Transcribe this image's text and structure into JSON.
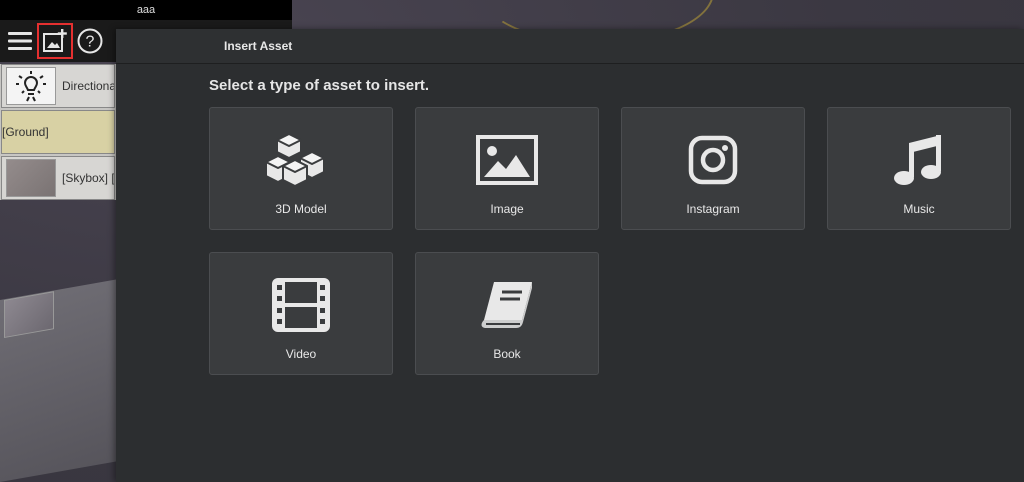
{
  "window": {
    "title": "aaa"
  },
  "toolbar": {
    "menu_icon": "hamburger-menu-icon",
    "insert_icon": "insert-image-plus-icon",
    "help_icon": "help-circle-icon",
    "highlight_color": "#e53030"
  },
  "objects": [
    {
      "label": "Directiona",
      "icon": "light-bulb-icon"
    },
    {
      "label": "[Ground]",
      "icon": "ground-thumbnail"
    },
    {
      "label": "[Skybox] [",
      "icon": "skybox-thumbnail"
    }
  ],
  "dialog": {
    "title": "Insert Asset",
    "subtitle": "Select a type of asset to insert.",
    "assets": [
      {
        "label": "3D Model",
        "icon": "cubes-icon"
      },
      {
        "label": "Image",
        "icon": "image-icon"
      },
      {
        "label": "Instagram",
        "icon": "instagram-icon"
      },
      {
        "label": "Music",
        "icon": "music-note-icon"
      },
      {
        "label": "Video",
        "icon": "film-icon"
      },
      {
        "label": "Book",
        "icon": "book-icon"
      }
    ]
  }
}
